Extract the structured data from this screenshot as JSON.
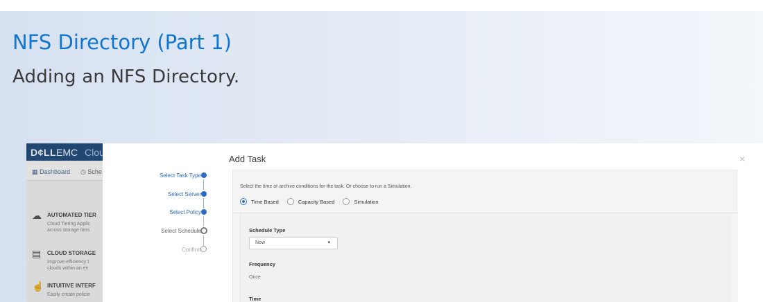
{
  "header": {
    "title": "NFS Directory (Part 1)",
    "subtitle": "Adding an NFS Directory."
  },
  "background_app": {
    "brand_bold": "D¢LL",
    "brand_light": "EMC",
    "app_name": "Clou",
    "nav": [
      {
        "label": "Dashboard",
        "icon": "dashboard-icon",
        "active": true
      },
      {
        "label": "Sche",
        "icon": "clock-icon",
        "active": false
      }
    ],
    "features": [
      {
        "icon": "cloud-tier-icon",
        "title": "AUTOMATED TIER",
        "desc": [
          "Cloud Tiering Applic",
          "across storage tiers"
        ]
      },
      {
        "icon": "cloud-storage-icon",
        "title": "CLOUD STORAGE",
        "desc": [
          "Improve efficiency t",
          "clouds within an en"
        ]
      },
      {
        "icon": "hand-pointer-icon",
        "title": "INTUITIVE INTERF",
        "desc": [
          "Easily create policie"
        ]
      }
    ]
  },
  "modal": {
    "title": "Add Task",
    "close_label": "×",
    "steps": [
      {
        "label": "Select Task Type",
        "state": "done"
      },
      {
        "label": "Select Server",
        "state": "done"
      },
      {
        "label": "Select Policy",
        "state": "done"
      },
      {
        "label": "Select Schedule",
        "state": "current"
      },
      {
        "label": "Confirm",
        "state": "pending"
      }
    ],
    "instruction": "Select the time or archive conditions for the task. Or choose to run a Simulation.",
    "options": [
      {
        "label": "Time Based",
        "selected": true
      },
      {
        "label": "Capacity Based",
        "selected": false
      },
      {
        "label": "Simulation",
        "selected": false
      }
    ],
    "schedule_type_label": "Schedule Type",
    "schedule_type_value": "Now",
    "frequency_label": "Frequency",
    "frequency_value": "Once",
    "time_label": "Time"
  },
  "colors": {
    "accent": "#1075cf",
    "step_done": "#2b6cc4",
    "dell_bar": "#0a3a73"
  }
}
